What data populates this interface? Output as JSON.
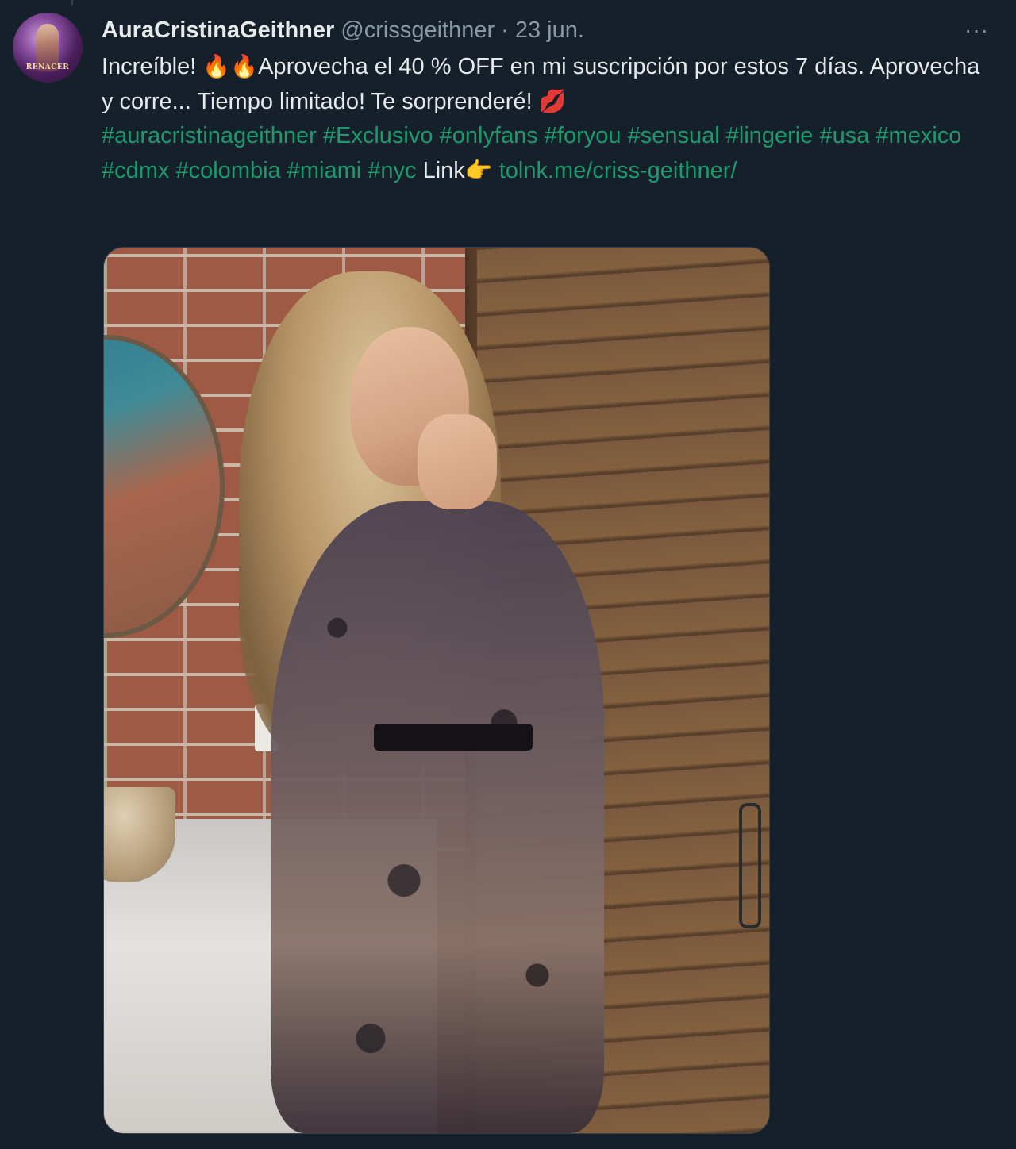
{
  "author": {
    "display_name": "AuraCristinaGeithner",
    "handle": "@crissgeithner",
    "separator": "·",
    "date": "23 jun.",
    "avatar_text": "RENACER"
  },
  "more_label": "···",
  "tweet": {
    "text_1": "Increíble! ",
    "emoji_fire_1": "🔥",
    "emoji_fire_2": "🔥",
    "text_2": "Aprovecha el 40 % OFF en mi suscripción por estos 7 días. Aprovecha y corre... Tiempo limitado! Te sorprenderé! ",
    "emoji_lips": "💋",
    "hashtags": [
      "#auracristinageithner",
      "#Exclusivo",
      "#onlyfans",
      "#foryou",
      "#sensual",
      "#lingerie",
      "#usa",
      "#mexico",
      "#cdmx",
      "#colombia",
      "#miami",
      "#nyc"
    ],
    "link_label": "Link",
    "emoji_point": "👉",
    "link_url": "tolnk.me/criss-geithner/"
  },
  "colors": {
    "background": "#15202b",
    "text_primary": "#e7e9ea",
    "text_secondary": "#8b98a5",
    "hashtag": "#1d9a6c"
  },
  "icons": {
    "more": "more-horizontal-icon"
  }
}
